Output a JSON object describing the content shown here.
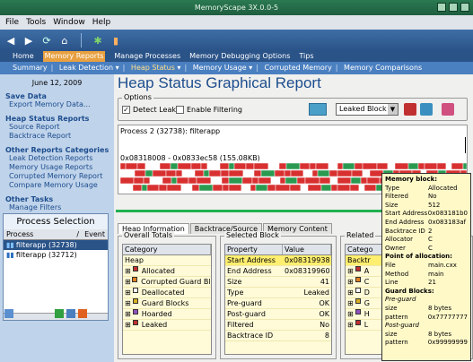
{
  "window": {
    "title": "MemoryScape 3X.0.0-5"
  },
  "menu": [
    "File",
    "Tools",
    "Window",
    "Help"
  ],
  "nav": [
    "Home",
    "Memory Reports",
    "Manage Processes",
    "Memory Debugging Options",
    "Tips"
  ],
  "subnav": [
    "Summary",
    "Leak Detection",
    "Heap Status",
    "Memory Usage",
    "Corrupted Memory",
    "Memory Comparisons"
  ],
  "sidebar": {
    "date": "June 12, 2009",
    "sections": [
      {
        "heading": "Save Data",
        "links": [
          "Export Memory Data..."
        ]
      },
      {
        "heading": "Heap Status Reports",
        "links": [
          "Source Report",
          "Backtrace Report"
        ]
      },
      {
        "heading": "Other Reports Categories",
        "links": [
          "Leak Detection Reports",
          "Memory Usage Reports",
          "Corrupted Memory Report",
          "Compare Memory Usage"
        ]
      },
      {
        "heading": "Other Tasks",
        "links": [
          "Manage Filters"
        ]
      }
    ],
    "process_selection": {
      "title": "Process Selection",
      "columns": [
        "Process",
        "/",
        "Event"
      ],
      "rows": [
        "filterapp (32738)",
        "filterapp (32712)"
      ]
    }
  },
  "main": {
    "title": "Heap Status Graphical Report",
    "options_legend": "Options",
    "detect_leaks": "Detect Leaks",
    "enable_filtering": "Enable Filtering",
    "leak_mode": "Leaked Block",
    "process_label": "Process 2 (32738): filterapp",
    "range": "0x08318008 - 0x0833ec58 (155.08KB)",
    "tabs": [
      "Heap Information",
      "Backtrace/Source",
      "Memory Content"
    ],
    "overall_totals": {
      "legend": "Overall Totals",
      "header": "Category",
      "rows": [
        {
          "label": "Heap",
          "color": ""
        },
        {
          "label": "Allocated",
          "color": "#c03030"
        },
        {
          "label": "Corrupted Guard Blo",
          "color": "#e08020"
        },
        {
          "label": "Deallocated",
          "color": "#ffffff"
        },
        {
          "label": "Guard Blocks",
          "color": "#d8b020"
        },
        {
          "label": "Hoarded",
          "color": "#9050c0"
        },
        {
          "label": "Leaked",
          "color": "#c03030"
        }
      ]
    },
    "selected_block": {
      "legend": "Selected Block",
      "columns": [
        "Property",
        "Value"
      ],
      "rows": [
        [
          "Start Address",
          "0x08319938"
        ],
        [
          "End Address",
          "0x08319960"
        ],
        [
          "Size",
          "41"
        ],
        [
          "Type",
          "Leaked"
        ],
        [
          "Pre-guard",
          "OK"
        ],
        [
          "Post-guard",
          "OK"
        ],
        [
          "Filtered",
          "No"
        ],
        [
          "Backtrace ID",
          "8"
        ]
      ]
    },
    "related": {
      "legend": "Related",
      "header": "Catego",
      "rows": [
        "Backtr",
        "A",
        "C",
        "D",
        "G",
        "H",
        "L"
      ]
    }
  },
  "tooltip": {
    "memory_block": "Memory block:",
    "block": [
      [
        "Type",
        "Allocated"
      ],
      [
        "Filtered",
        "No"
      ],
      [
        "Size",
        "512"
      ],
      [
        "Start Address",
        "0x083181b0"
      ],
      [
        "End Address",
        "0x083183af"
      ],
      [
        "Backtrace ID",
        "2"
      ],
      [
        "Allocator",
        "C"
      ],
      [
        "Owner",
        "C"
      ]
    ],
    "point": "Point of allocation:",
    "alloc": [
      [
        "File",
        "main.cxx"
      ],
      [
        "Method",
        "main"
      ],
      [
        "Line",
        "21"
      ]
    ],
    "guard": "Guard Blocks:",
    "pre": "Pre-guard",
    "pre_rows": [
      [
        "size",
        "8 bytes"
      ],
      [
        "pattern",
        "0x77777777"
      ]
    ],
    "post": "Post-guard",
    "post_rows": [
      [
        "size",
        "8 bytes"
      ],
      [
        "pattern",
        "0x99999999"
      ]
    ]
  }
}
